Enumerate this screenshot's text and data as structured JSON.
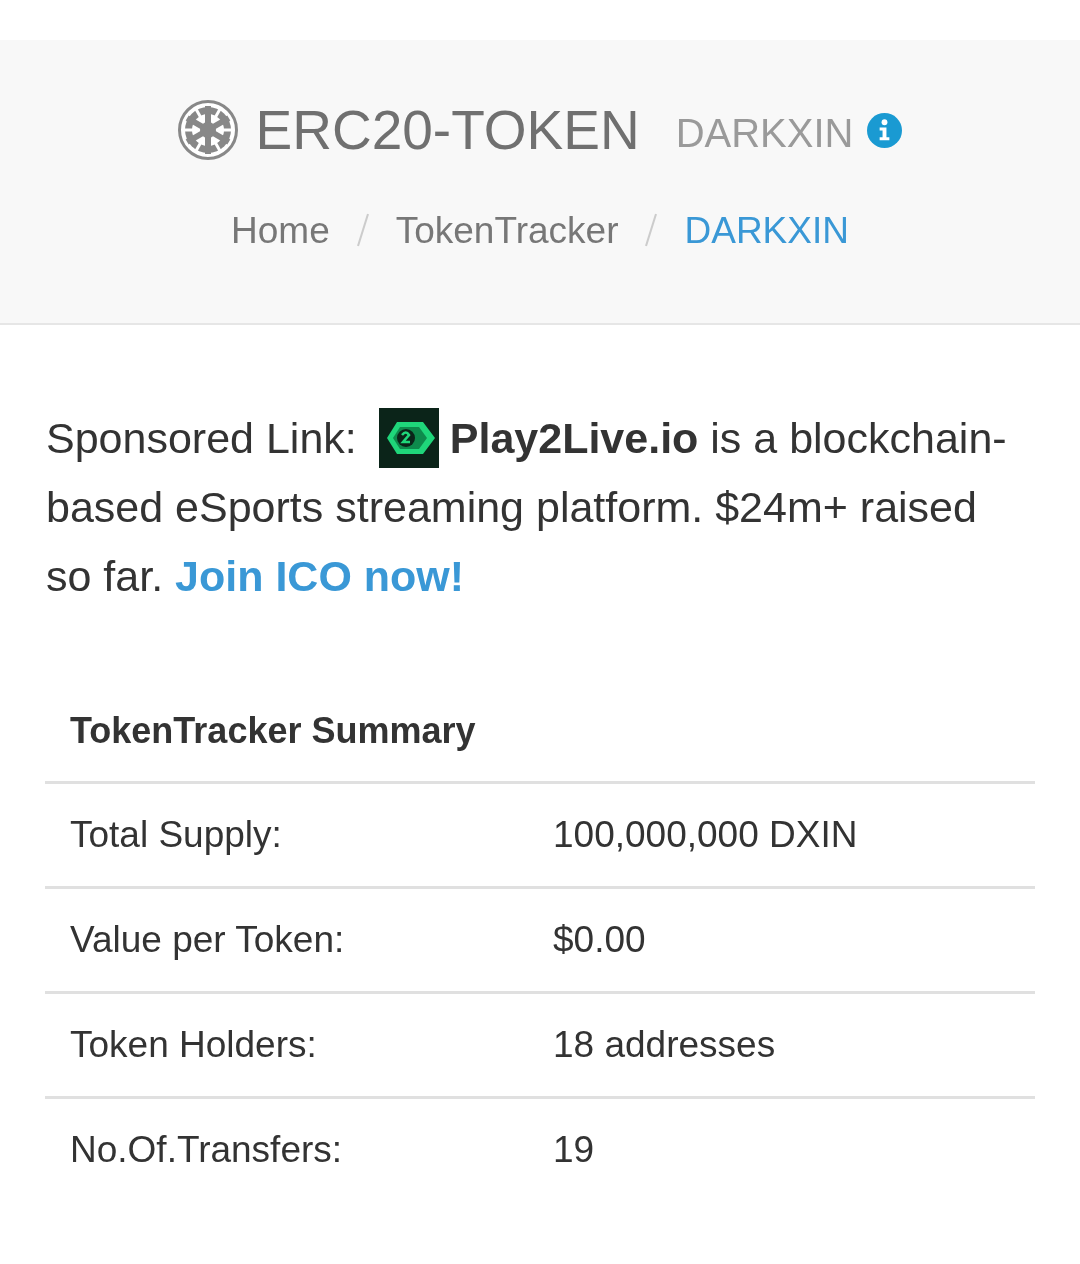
{
  "header": {
    "title": "ERC20-TOKEN",
    "token_name": "DARKXIN"
  },
  "breadcrumb": [
    {
      "label": "Home",
      "current": false
    },
    {
      "label": "TokenTracker",
      "current": false
    },
    {
      "label": "DARKXIN",
      "current": true
    }
  ],
  "sponsored": {
    "label": "Sponsored Link:",
    "text": "**Play2Live.io** is a blockchain-based eSports streaming platform. $24m+ raised so far.",
    "link": "Join ICO now!"
  },
  "summary": {
    "title": "TokenTracker Summary",
    "rows": [
      {
        "label": "Total Supply:",
        "value": "100,000,000 DXIN"
      },
      {
        "label": "Value per Token:",
        "value": "$0.00"
      },
      {
        "label": "Token Holders:",
        "value": "18 addresses"
      },
      {
        "label": "No.Of.Transfers:",
        "value": "19"
      }
    ]
  }
}
